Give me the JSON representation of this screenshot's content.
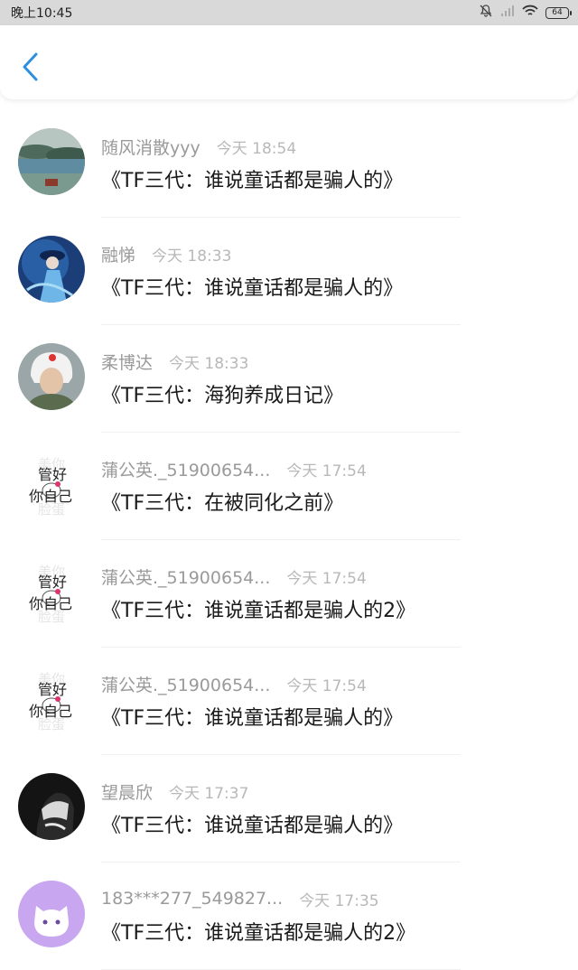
{
  "status_bar": {
    "time": "晚上10:45",
    "battery": "64"
  },
  "header": {
    "back_icon": "chevron-left-icon",
    "accent_color": "#2d8fe0"
  },
  "items": [
    {
      "username": "随风消散yyy",
      "time": "今天 18:54",
      "title": "《TF三代：谁说童话都是骗人的》",
      "avatar": "landscape-avatar"
    },
    {
      "username": "融悌",
      "time": "今天 18:33",
      "title": "《TF三代：谁说童话都是骗人的》",
      "avatar": "blue-figure-avatar"
    },
    {
      "username": "柔博达",
      "time": "今天 18:33",
      "title": "《TF三代：海狗养成日记》",
      "avatar": "pilot-avatar"
    },
    {
      "username": "蒲公英._51900654...",
      "time": "今天 17:54",
      "title": "《TF三代：在被同化之前》",
      "avatar": "hello-kitty-avatar",
      "avatar_text": [
        "管好",
        "你自己"
      ]
    },
    {
      "username": "蒲公英._51900654...",
      "time": "今天 17:54",
      "title": "《TF三代：谁说童话都是骗人的2》",
      "avatar": "hello-kitty-avatar",
      "avatar_text": [
        "管好",
        "你自己"
      ]
    },
    {
      "username": "蒲公英._51900654...",
      "time": "今天 17:54",
      "title": "《TF三代：谁说童话都是骗人的》",
      "avatar": "hello-kitty-avatar",
      "avatar_text": [
        "管好",
        "你自己"
      ]
    },
    {
      "username": "望晨欣",
      "time": "今天 17:37",
      "title": "《TF三代：谁说童话都是骗人的》",
      "avatar": "dark-photo-avatar"
    },
    {
      "username": "183***277_549827...",
      "time": "今天 17:35",
      "title": "《TF三代：谁说童话都是骗人的2》",
      "avatar": "purple-cat-avatar"
    }
  ]
}
